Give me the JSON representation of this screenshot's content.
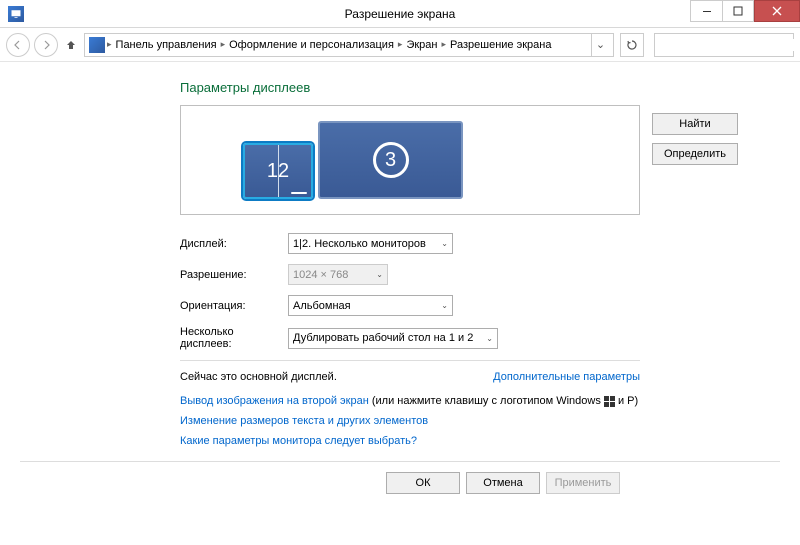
{
  "window": {
    "title": "Разрешение экрана"
  },
  "breadcrumb": {
    "items": [
      "Панель управления",
      "Оформление и персонализация",
      "Экран",
      "Разрешение экрана"
    ]
  },
  "heading": "Параметры дисплеев",
  "side_buttons": {
    "find": "Найти",
    "detect": "Определить"
  },
  "monitors": {
    "combined_label_1": "1",
    "combined_label_2": "2",
    "big_label": "3"
  },
  "form": {
    "display_label": "Дисплей:",
    "display_value": "1|2. Несколько мониторов",
    "resolution_label": "Разрешение:",
    "resolution_value": "1024 × 768",
    "orientation_label": "Ориентация:",
    "orientation_value": "Альбомная",
    "multi_label": "Несколько дисплеев:",
    "multi_value": "Дублировать рабочий стол на 1 и 2"
  },
  "info": {
    "primary_text": "Сейчас это основной дисплей.",
    "advanced_link": "Дополнительные параметры"
  },
  "links": {
    "project_link": "Вывод изображения на второй экран",
    "project_suffix": " (или нажмите клавишу с логотипом Windows ",
    "project_suffix2": " и P)",
    "text_size_link": "Изменение размеров текста и других элементов",
    "which_settings_link": "Какие параметры монитора следует выбрать?"
  },
  "buttons": {
    "ok": "ОК",
    "cancel": "Отмена",
    "apply": "Применить"
  }
}
